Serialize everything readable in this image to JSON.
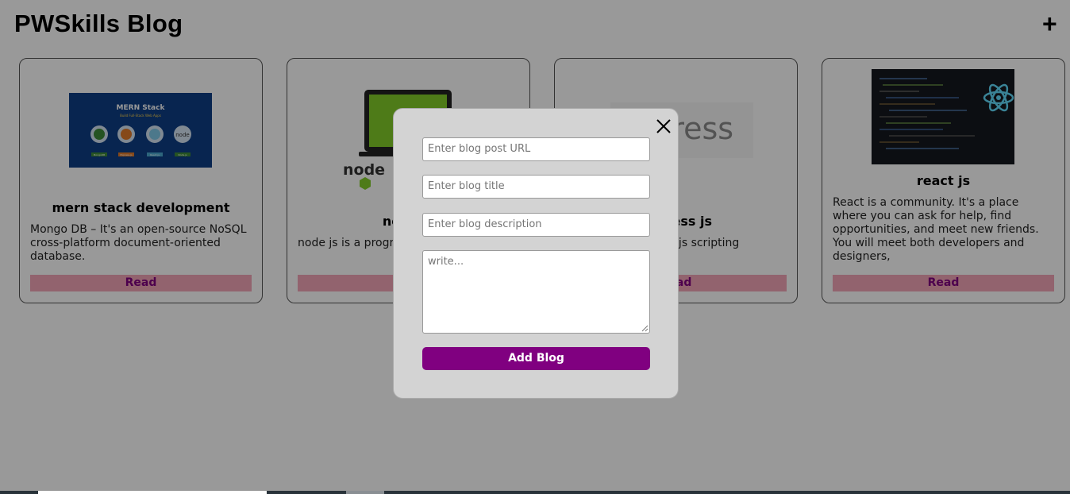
{
  "header": {
    "title": "PWSkills Blog",
    "add_label": "+"
  },
  "cards": [
    {
      "title": "mern stack development",
      "description": "Mongo DB – It's an open-source NoSQL cross-platform document-oriented database.",
      "read_label": "Read",
      "image": {
        "heading": "MERN Stack",
        "subheading": "Build Full-Stack Web Apps",
        "badges": [
          "MongoDB",
          "Express.js",
          "React.js",
          "Node.js"
        ],
        "icons": [
          "M",
          "E",
          "⚛",
          "node"
        ]
      }
    },
    {
      "title": "node js",
      "description": "node js is a program to run for backend",
      "read_label": "Read",
      "image": {
        "logo": "node"
      }
    },
    {
      "title": "express js",
      "description": "framework for node js scripting",
      "read_label": "Read",
      "image": {
        "logo": "express"
      }
    },
    {
      "title": "react js",
      "description": "React is a community. It's a place where you can ask for help, find opportunities, and meet new friends. You will meet both developers and designers,",
      "read_label": "Read",
      "image": {
        "logo": "react-atom-icon"
      }
    }
  ],
  "modal": {
    "url_placeholder": "Enter blog post URL",
    "title_placeholder": "Enter blog title",
    "description_placeholder": "Enter blog description",
    "content_placeholder": "write...",
    "submit_label": "Add Blog"
  },
  "colors": {
    "accent": "#800080",
    "read_bg": "#f4a5b8",
    "modal_bg": "#d3d3d3"
  }
}
